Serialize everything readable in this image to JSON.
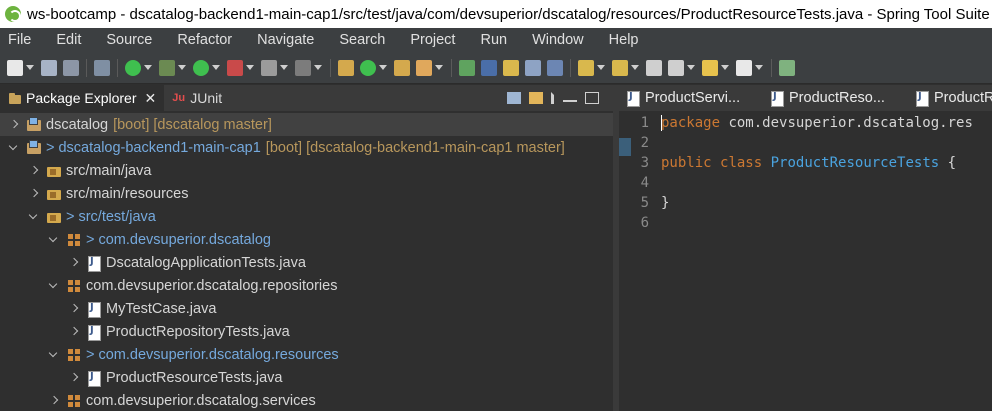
{
  "window": {
    "title": "ws-bootcamp - dscatalog-backend1-main-cap1/src/test/java/com/devsuperior/dscatalog/resources/ProductResourceTests.java - Spring Tool Suite 4"
  },
  "menu": [
    "File",
    "Edit",
    "Source",
    "Refactor",
    "Navigate",
    "Search",
    "Project",
    "Run",
    "Window",
    "Help"
  ],
  "left_panel": {
    "tabs": [
      {
        "label": "Package Explorer",
        "active": true,
        "icon": "package-explorer-icon",
        "close": "✕"
      },
      {
        "label": "JUnit",
        "active": false,
        "icon": "junit-icon",
        "glyph": "Ju"
      }
    ],
    "tree": [
      {
        "chev": "right",
        "icon": "project",
        "prefix": "",
        "label": "dscatalog",
        "meta": "[boot] [dscatalog master]",
        "changed": false,
        "selected": true
      },
      {
        "chev": "down",
        "icon": "project",
        "prefix": ">",
        "label": "dscatalog-backend1-main-cap1",
        "meta": "[boot] [dscatalog-backend1-main-cap1 master]",
        "changed": true,
        "selected": false
      },
      {
        "chev": "right",
        "icon": "srcfolder",
        "prefix": "",
        "label": "src/main/java",
        "meta": "",
        "changed": false,
        "selected": false
      },
      {
        "chev": "right",
        "icon": "srcfolder",
        "prefix": "",
        "label": "src/main/resources",
        "meta": "",
        "changed": false,
        "selected": false
      },
      {
        "chev": "down",
        "icon": "srcfolder",
        "prefix": ">",
        "label": "src/test/java",
        "meta": "",
        "changed": true,
        "selected": false
      },
      {
        "chev": "down",
        "icon": "package",
        "prefix": ">",
        "label": "com.devsuperior.dscatalog",
        "meta": "",
        "changed": true,
        "selected": false
      },
      {
        "chev": "right",
        "icon": "javafile",
        "prefix": "",
        "label": "DscatalogApplicationTests.java",
        "meta": "",
        "changed": false,
        "selected": false
      },
      {
        "chev": "down",
        "icon": "package",
        "prefix": "",
        "label": "com.devsuperior.dscatalog.repositories",
        "meta": "",
        "changed": false,
        "selected": false
      },
      {
        "chev": "right",
        "icon": "javafile",
        "prefix": "",
        "label": "MyTestCase.java",
        "meta": "",
        "changed": false,
        "selected": false
      },
      {
        "chev": "right",
        "icon": "javafile",
        "prefix": "",
        "label": "ProductRepositoryTests.java",
        "meta": "",
        "changed": false,
        "selected": false
      },
      {
        "chev": "down",
        "icon": "package",
        "prefix": ">",
        "label": "com.devsuperior.dscatalog.resources",
        "meta": "",
        "changed": true,
        "selected": false
      },
      {
        "chev": "right",
        "icon": "javafile",
        "prefix": "",
        "label": "ProductResourceTests.java",
        "meta": "",
        "changed": false,
        "selected": false
      },
      {
        "chev": "right",
        "icon": "package",
        "prefix": "",
        "label": "com.devsuperior.dscatalog.services",
        "meta": "",
        "changed": false,
        "selected": false
      }
    ]
  },
  "editor": {
    "tabs": [
      {
        "label": "ProductServi..."
      },
      {
        "label": "ProductReso..."
      },
      {
        "label": "ProductRe"
      }
    ],
    "lines": [
      {
        "n": "1",
        "parts": [
          {
            "t": "package",
            "c": "kw"
          },
          {
            "t": " com.devsuperior.dscatalog.res",
            "c": ""
          }
        ]
      },
      {
        "n": "2",
        "parts": []
      },
      {
        "n": "3",
        "parts": [
          {
            "t": "public",
            "c": "kw"
          },
          {
            "t": " ",
            "c": ""
          },
          {
            "t": "class",
            "c": "kw"
          },
          {
            "t": " ",
            "c": ""
          },
          {
            "t": "ProductResourceTests",
            "c": "cls"
          },
          {
            "t": " {",
            "c": ""
          }
        ]
      },
      {
        "n": "4",
        "parts": []
      },
      {
        "n": "5",
        "parts": [
          {
            "t": "}",
            "c": ""
          }
        ]
      },
      {
        "n": "6",
        "parts": []
      }
    ]
  },
  "colors": {
    "accent": "#75a9dd",
    "keyword": "#cc7832",
    "class": "#4aa3df",
    "meta": "#b8975c"
  }
}
